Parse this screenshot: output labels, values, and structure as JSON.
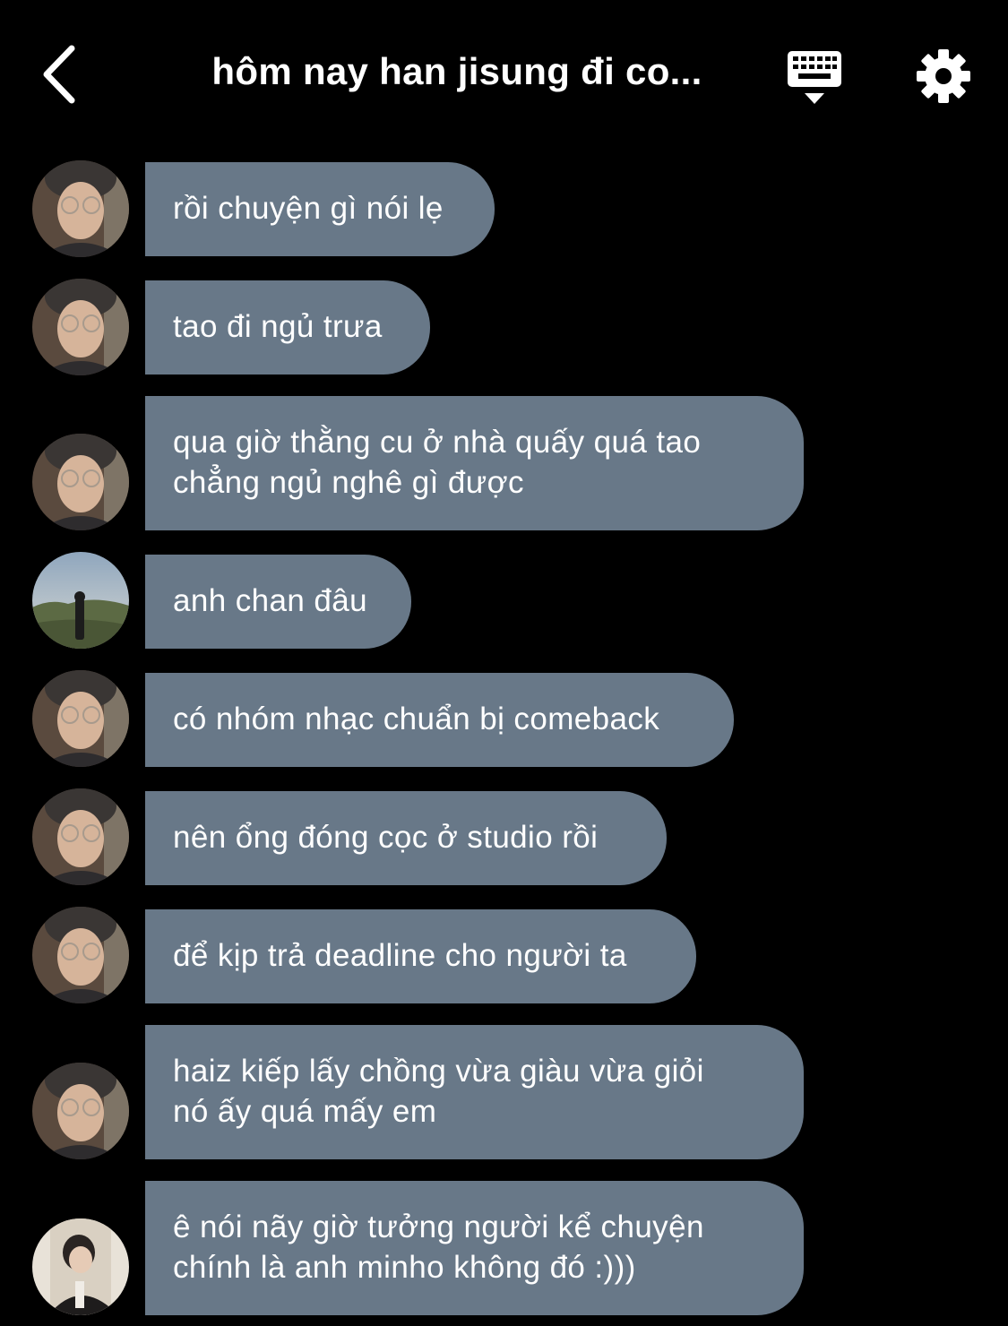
{
  "header": {
    "title": "hôm nay han jisung đi co...",
    "back_icon": "chevron-left-icon",
    "keyboard_icon": "keyboard-icon",
    "settings_icon": "gear-icon"
  },
  "colors": {
    "background": "#000000",
    "bubble": "#687888",
    "text": "#ffffff"
  },
  "messages": [
    {
      "avatar": "avatar-jisung",
      "lines": [
        "rồi chuyện gì nói lẹ"
      ]
    },
    {
      "avatar": "avatar-jisung",
      "lines": [
        "tao đi ngủ trưa"
      ]
    },
    {
      "avatar": "avatar-jisung",
      "lines": [
        "qua giờ thằng cu ở nhà quấy quá tao",
        "chẳng ngủ nghê gì được"
      ]
    },
    {
      "avatar": "avatar-landscape",
      "lines": [
        "anh chan đâu"
      ]
    },
    {
      "avatar": "avatar-jisung",
      "lines": [
        "có nhóm nhạc chuẩn bị comeback"
      ]
    },
    {
      "avatar": "avatar-jisung",
      "lines": [
        "nên ổng đóng cọc ở studio rồi"
      ]
    },
    {
      "avatar": "avatar-jisung",
      "lines": [
        "để kịp trả deadline cho người ta"
      ]
    },
    {
      "avatar": "avatar-jisung",
      "lines": [
        "haiz kiếp lấy chồng vừa giàu vừa giỏi",
        "nó ấy quá mấy em"
      ]
    },
    {
      "avatar": "avatar-portrait",
      "lines": [
        "ê nói nãy giờ tưởng người kể chuyện",
        "chính là anh minho không đó :)))"
      ]
    }
  ]
}
